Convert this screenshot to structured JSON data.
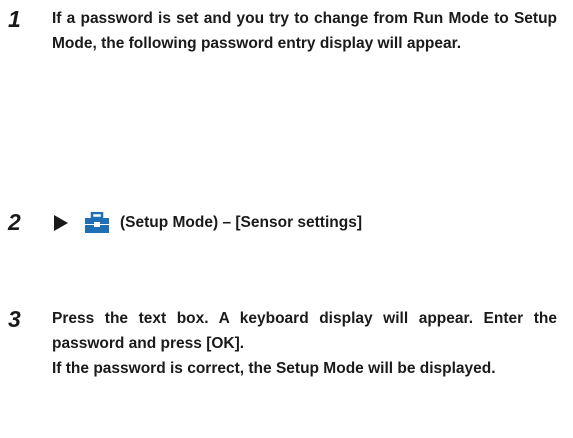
{
  "steps": [
    {
      "number": "1",
      "text": "If a password is set and you try to change from Run Mode to Setup Mode, the following password entry display will appear."
    },
    {
      "number": "2",
      "icon": "setup-mode-toolbox-icon",
      "text": "(Setup Mode) – [Sensor settings]",
      "icon_color": "#1f6fb5"
    },
    {
      "number": "3",
      "text_line_1": "Press the text box. A keyboard display will appear. Enter the password and press [OK].",
      "text_line_2": "If the password is correct, the Setup Mode will be displayed."
    }
  ]
}
